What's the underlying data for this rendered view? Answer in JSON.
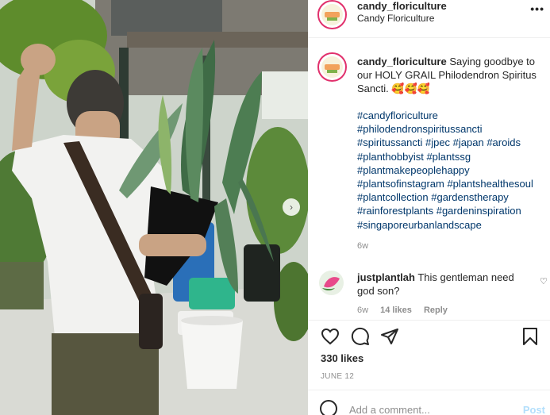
{
  "post": {
    "username": "candy_floriculture",
    "full_name": "Candy Floriculture",
    "more_icon": "more-horizontal-icon",
    "avatar_text": "Candy"
  },
  "caption": {
    "username": "candy_floriculture",
    "text": "Saying goodbye to our HOLY GRAIL Philodendron Spiritus Sancti. 🥰🥰🥰",
    "hashtag_lines": [
      "#candyfloriculture",
      "#philodendronspiritussancti",
      "#spiritussancti #jpec #japan #aroids",
      "#planthobbyist #plantssg",
      "#plantmakepeoplehappy",
      "#plantsofinstagram #plantshealthesoul",
      "#plantcollection #gardenstherapy",
      "#rainforestplants #gardeninspiration",
      "#singaporeurbanlandscape"
    ],
    "time": "6w"
  },
  "comment": {
    "username": "justplantlah",
    "text": "This gentleman need god son?",
    "time": "6w",
    "likes": "14 likes",
    "reply": "Reply"
  },
  "actions": {
    "like_icon": "heart-icon",
    "comment_icon": "comment-icon",
    "share_icon": "send-icon",
    "save_icon": "bookmark-icon"
  },
  "likes": "330 likes",
  "date": "JUNE 12",
  "add_comment": {
    "placeholder": "Add a comment...",
    "post_label": "Post"
  },
  "colors": {
    "link": "#00376b",
    "muted": "#8e8e8e",
    "post_button": "#b2dffc",
    "avatar_ring": "#e1306c"
  }
}
